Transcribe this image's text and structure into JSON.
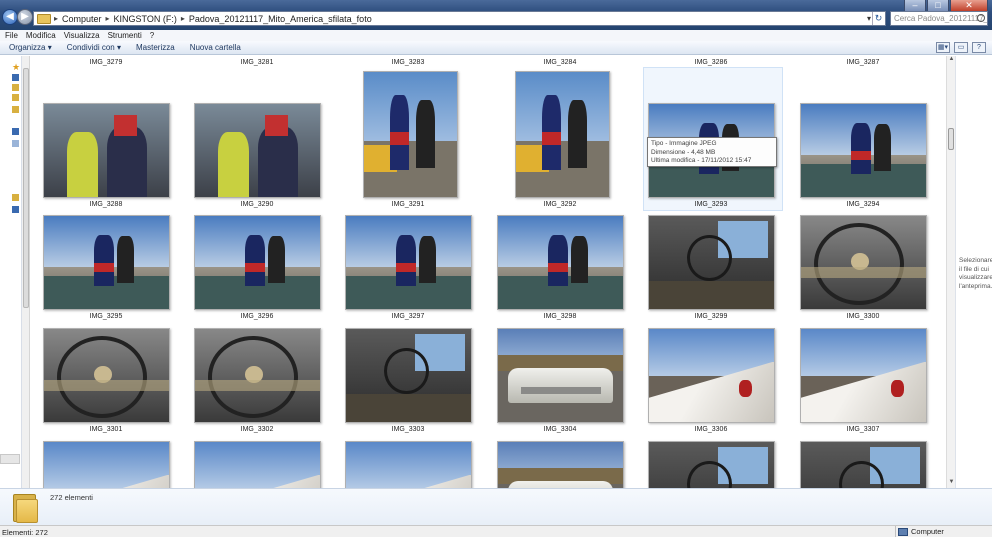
{
  "address": {
    "crumbs": [
      "Computer",
      "KINGSTON (F:)",
      "Padova_20121117_Mito_America_sfilata_foto"
    ],
    "search_placeholder": "Cerca Padova_20121117_Mito..."
  },
  "menu": [
    "File",
    "Modifica",
    "Visualizza",
    "Strumenti",
    "?"
  ],
  "toolbar": {
    "organize": "Organizza",
    "share": "Condividi con",
    "burn": "Masterizza",
    "new_folder": "Nuova cartella"
  },
  "top_row_labels": [
    "IMG_3279",
    "IMG_3281",
    "IMG_3283",
    "IMG_3284",
    "IMG_3286",
    "IMG_3287"
  ],
  "rows": [
    {
      "items": [
        {
          "name": "IMG_3288",
          "orient": "land",
          "scene": "people"
        },
        {
          "name": "IMG_3290",
          "orient": "land",
          "scene": "people"
        },
        {
          "name": "IMG_3291",
          "orient": "port",
          "scene": "car-girls"
        },
        {
          "name": "IMG_3292",
          "orient": "port",
          "scene": "car-girls"
        },
        {
          "name": "IMG_3293",
          "orient": "land",
          "scene": "girls"
        },
        {
          "name": "IMG_3294",
          "orient": "land",
          "scene": "girls"
        }
      ]
    },
    {
      "items": [
        {
          "name": "IMG_3295",
          "orient": "land",
          "scene": "girls"
        },
        {
          "name": "IMG_3296",
          "orient": "land",
          "scene": "girls"
        },
        {
          "name": "IMG_3297",
          "orient": "land",
          "scene": "girls"
        },
        {
          "name": "IMG_3298",
          "orient": "land",
          "scene": "girls"
        },
        {
          "name": "IMG_3299",
          "orient": "land",
          "scene": "interior"
        },
        {
          "name": "IMG_3300",
          "orient": "land",
          "scene": "wheel"
        }
      ]
    },
    {
      "items": [
        {
          "name": "IMG_3301",
          "orient": "land",
          "scene": "wheel"
        },
        {
          "name": "IMG_3302",
          "orient": "land",
          "scene": "wheel"
        },
        {
          "name": "IMG_3303",
          "orient": "land",
          "scene": "interior"
        },
        {
          "name": "IMG_3304",
          "orient": "land",
          "scene": "car-front"
        },
        {
          "name": "IMG_3306",
          "orient": "land",
          "scene": "tailfin"
        },
        {
          "name": "IMG_3307",
          "orient": "land",
          "scene": "tailfin"
        }
      ]
    },
    {
      "items": [
        {
          "name": "",
          "orient": "land",
          "scene": "tailfin"
        },
        {
          "name": "",
          "orient": "land",
          "scene": "tailfin"
        },
        {
          "name": "",
          "orient": "land",
          "scene": "tailfin"
        },
        {
          "name": "",
          "orient": "land",
          "scene": "car-front"
        },
        {
          "name": "",
          "orient": "land",
          "scene": "interior"
        },
        {
          "name": "",
          "orient": "land",
          "scene": "interior"
        }
      ]
    }
  ],
  "selected_item": "IMG_3293",
  "tooltip": {
    "type": "Tipo - Immagine JPEG",
    "size": "Dimensione - 4,48 MB",
    "modified": "Ultima modifica - 17/11/2012 15:47"
  },
  "preview_hint": "Selezionare il file di cui visualizzare l'anteprima.",
  "details": {
    "count": "272 elementi"
  },
  "status": {
    "left": "Elementi: 272",
    "right": "Computer"
  }
}
